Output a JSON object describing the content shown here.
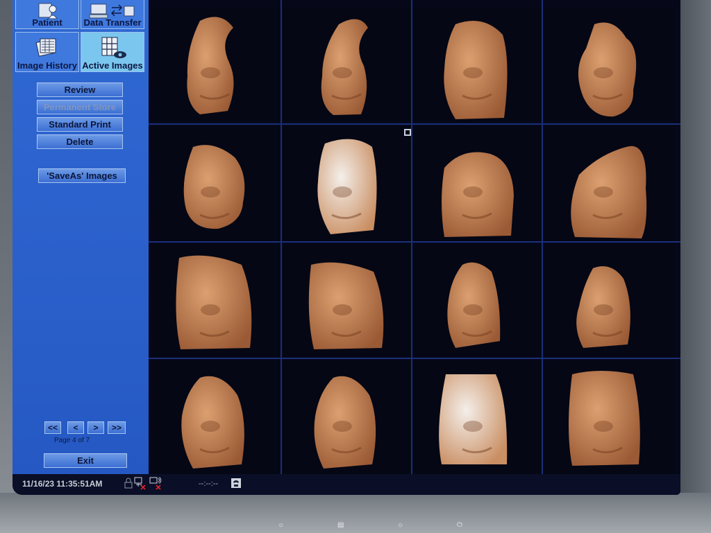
{
  "panel": {
    "tiles": [
      {
        "label": "Patient",
        "icon": "patient-icon",
        "active": false
      },
      {
        "label": "Data Transfer",
        "icon": "data-transfer-icon",
        "active": false
      },
      {
        "label": "Image History",
        "icon": "image-history-icon",
        "active": false
      },
      {
        "label": "Active Images",
        "icon": "active-images-icon",
        "active": true
      }
    ],
    "buttons": {
      "review": "Review",
      "permanent_store": "Permanent Store",
      "standard_print": "Standard Print",
      "delete": "Delete",
      "save_as": "'SaveAs' Images",
      "exit": "Exit"
    },
    "pager": {
      "first": "<<",
      "prev": "<",
      "next": ">",
      "last": ">>",
      "label": "Page 4 of 7"
    }
  },
  "status": {
    "datetime": "11/16/23 11:35:51AM",
    "timer": "--:--:--"
  },
  "images": {
    "count": 16,
    "selected_icon": "selection-marker-icon"
  },
  "colors": {
    "panel_blue": "#2f68d2",
    "active_tile": "#7ac6ee",
    "grid_line": "#1b2f7a",
    "tissue": "#d69a6a"
  }
}
